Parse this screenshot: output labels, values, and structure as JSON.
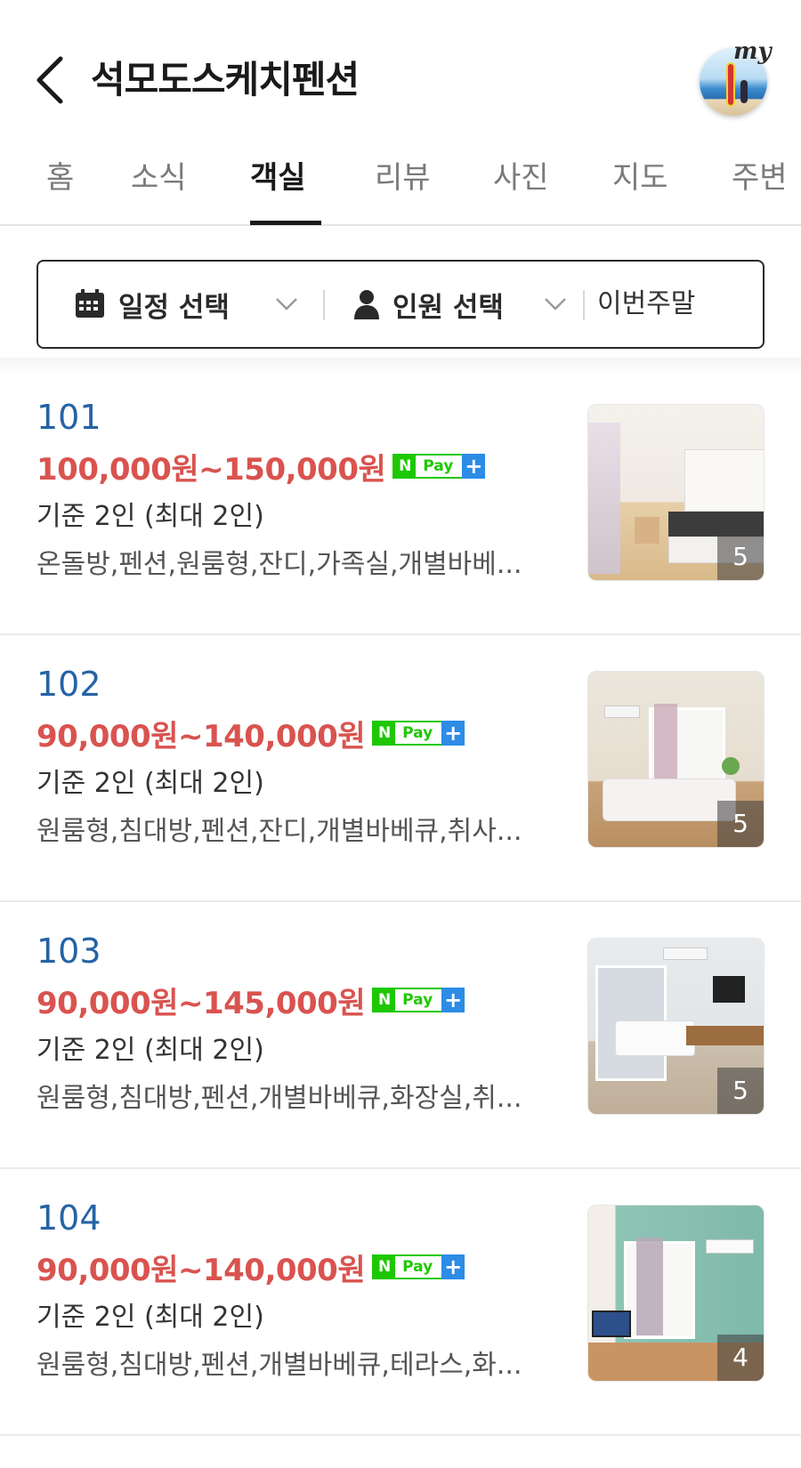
{
  "header": {
    "title": "석모도스케치펜션",
    "my_badge": "my"
  },
  "tabs": [
    {
      "label": "홈"
    },
    {
      "label": "소식"
    },
    {
      "label": "객실"
    },
    {
      "label": "리뷰"
    },
    {
      "label": "사진"
    },
    {
      "label": "지도"
    },
    {
      "label": "주변"
    }
  ],
  "active_tab": "객실",
  "filter": {
    "date_label": "일정 선택",
    "people_label": "인원 선택",
    "weekend_label": "이번주말"
  },
  "npay": {
    "n": "N",
    "pay": "Pay",
    "plus": "+"
  },
  "rooms": [
    {
      "name": "101",
      "price": "100,000원~150,000원",
      "capacity": "기준 2인 (최대 2인)",
      "tags": "온돌방,펜션,원룸형,잔디,가족실,개별바베...",
      "photo_count": "5"
    },
    {
      "name": "102",
      "price": "90,000원~140,000원",
      "capacity": "기준 2인 (최대 2인)",
      "tags": "원룸형,침대방,펜션,잔디,개별바베큐,취사...",
      "photo_count": "5"
    },
    {
      "name": "103",
      "price": "90,000원~145,000원",
      "capacity": "기준 2인 (최대 2인)",
      "tags": "원룸형,침대방,펜션,개별바베큐,화장실,취...",
      "photo_count": "5"
    },
    {
      "name": "104",
      "price": "90,000원~140,000원",
      "capacity": "기준 2인 (최대 2인)",
      "tags": "원룸형,침대방,펜션,개별바베큐,테라스,화...",
      "photo_count": "4"
    }
  ],
  "colors": {
    "price": "#d9534f",
    "room_name": "#2563a6",
    "npay_green": "#1ec800",
    "npay_blue": "#2c8ce6"
  },
  "icons": [
    "back-arrow-icon",
    "calendar-icon",
    "person-icon",
    "chevron-down-icon"
  ]
}
